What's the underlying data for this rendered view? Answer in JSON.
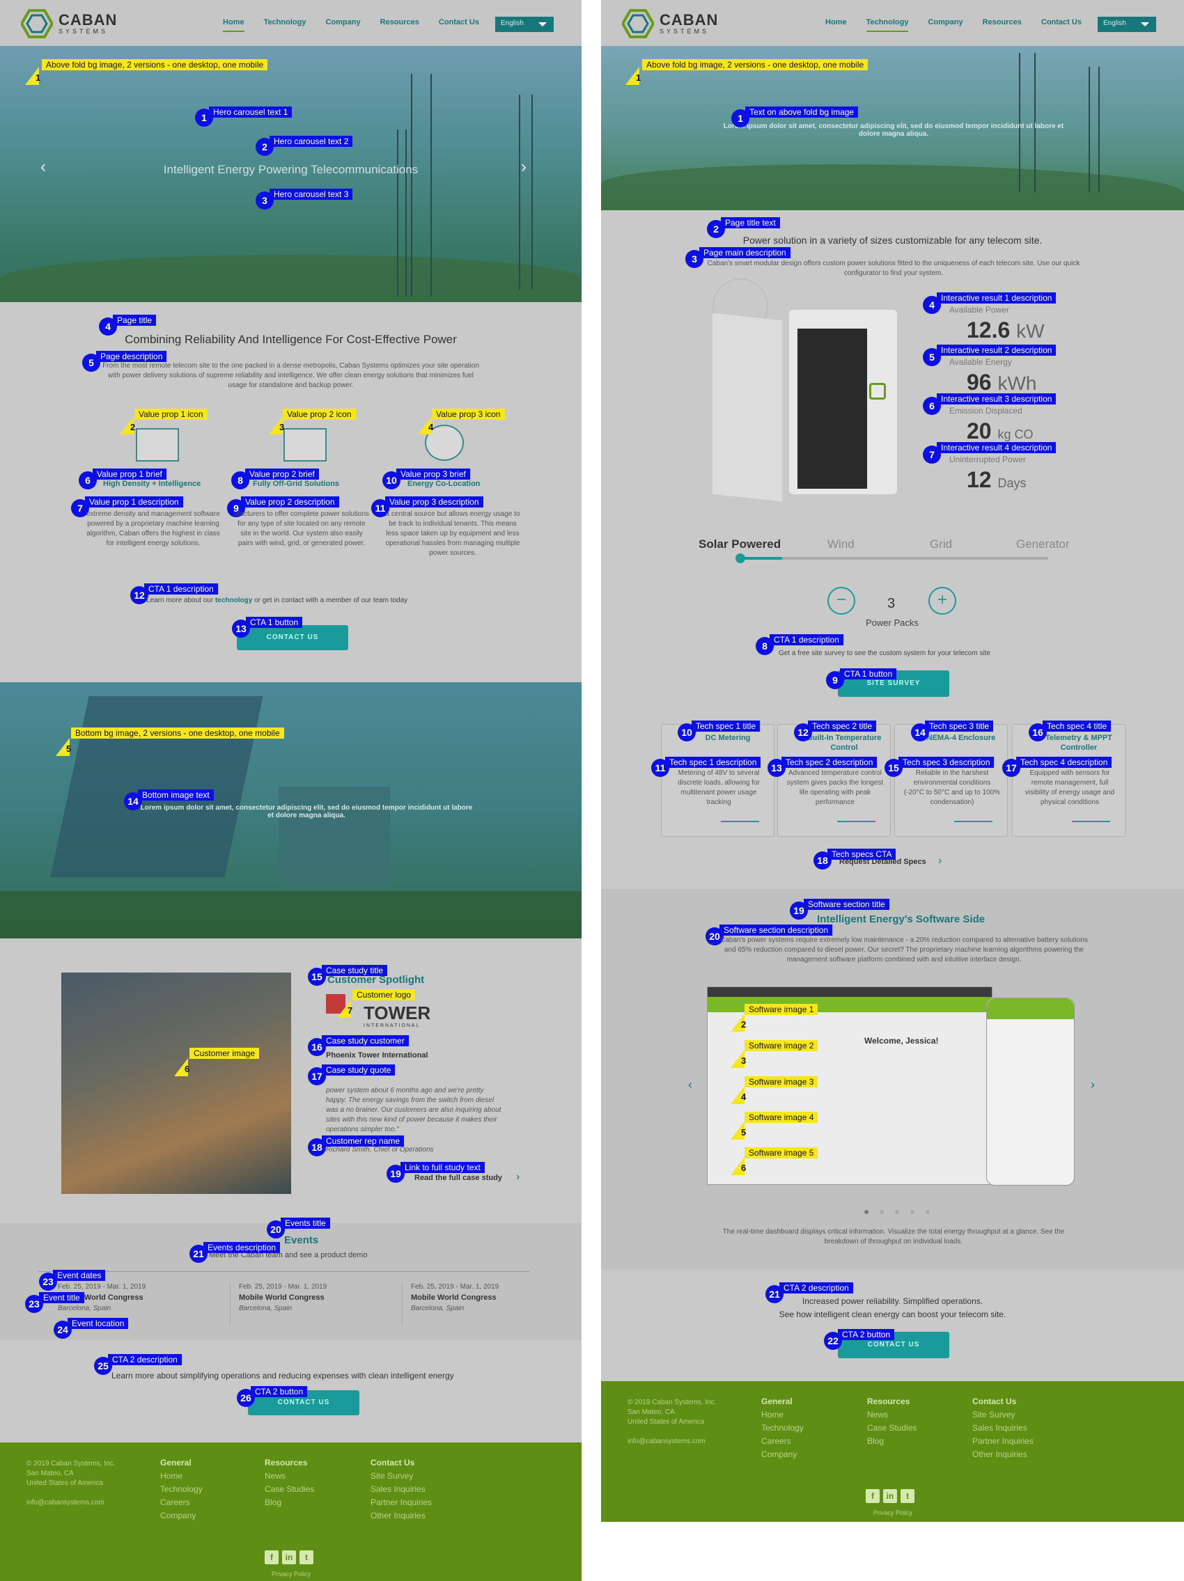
{
  "p1": {
    "logo": {
      "t1": "CABAN",
      "t2": "SYSTEMS"
    },
    "menu": [
      "Home",
      "Technology",
      "Company",
      "Resources",
      "Contact Us"
    ],
    "lang": "English",
    "hero_tag": "Above fold bg image, 2 versions - one desktop, one mobile",
    "hero_texts": [
      "Hero carousel text 1",
      "Hero carousel text 2",
      "Hero carousel text 3"
    ],
    "hero_main": "Intelligent Energy Powering Telecommunications",
    "page_title_tag": "Page title",
    "page_title": "Combining Reliability And Intelligence For Cost-Effective Power",
    "page_desc_tag": "Page description",
    "page_desc": "From the most remote telecom site to the one packed in a dense metropolis, Caban Systems optimizes your site operation with power delivery solutions of supreme reliability and intelligence. We offer clean energy solutions that minimizes fuel usage for standalone and backup power.",
    "vp_icon_tags": [
      "Value prop 1 icon",
      "Value prop 2 icon",
      "Value prop 3 icon"
    ],
    "vp_brief_tags": [
      "Value prop 1 brief",
      "Value prop 2 brief",
      "Value prop 3 brief"
    ],
    "vp_briefs": [
      "High Density + Intelligence",
      "Fully Off-Grid Solutions",
      "Energy Co-Location"
    ],
    "vp_desc_tags": [
      "Value prop 1 description",
      "Value prop 2 description",
      "Value prop 3 description"
    ],
    "vp_descs": [
      "extreme density and management software powered by a proprietary machine learning algorithm, Caban offers the highest in class for intelligent energy solutions.",
      "ufacturers to offer complete power solutions for any type of site located on any remote site in the world. Our system also easily pairs with wind, grid, or generated power.",
      "a central source but allows energy usage to be track to individual tenants. This means less space taken up by equipment and less operational hassles from managing multiple power sources."
    ],
    "cta1_tag": "CTA 1 description",
    "cta1_pre": "Learn more about our ",
    "cta1_link": "technology",
    "cta1_post": " or get in contact with a member of our team today",
    "cta1_btn_tag": "CTA 1 button",
    "cta1_btn": "CONTACT US",
    "bottom_tag": "Bottom bg image, 2 versions - one desktop, one mobile",
    "bottom_text_tag": "Bottom image text",
    "bottom_text": "Lorem ipsum dolor sit amet, consectetur adipiscing elit, sed do eiusmod tempor incididunt ut labore et dolore magna aliqua.",
    "case_title_tag": "Case study title",
    "case_title": "Customer Spotlight",
    "case_logo_tag": "Customer logo",
    "case_logo": "TOWER",
    "case_logo_sub": "INTERNATIONAL",
    "case_image_tag": "Customer image",
    "case_customer_tag": "Case study customer",
    "case_customer": "Phoenix Tower International",
    "case_quote_tag": "Case study quote",
    "case_quote": "power system about 6 months ago and we're pretty happy. The energy savings from the switch from diesel was a no brainer. Our customers are also inquiring about sites with this new kind of power because it makes their operations simpler too.\"",
    "case_rep_tag": "Customer rep name",
    "case_rep": "Richard Smith, Chief of Operations",
    "case_link_tag": "Link to full study text",
    "case_link": "Read the full case study",
    "events_title_tag": "Events title",
    "events_title": "Events",
    "events_desc_tag": "Events description",
    "events_desc": "Meet the Caban team and see a product demo",
    "event_dates_tag": "Event dates",
    "event_title_tag": "Event title",
    "event_loc_tag": "Event location",
    "events": [
      {
        "date": "Feb. 25, 2019 - Mar. 1, 2019",
        "title": "Mobile World Congress",
        "loc": "Barcelona, Spain"
      },
      {
        "date": "Feb. 25, 2019 - Mar. 1, 2019",
        "title": "Mobile World Congress",
        "loc": "Barcelona, Spain"
      },
      {
        "date": "Feb. 25, 2019 - Mar. 1, 2019",
        "title": "Mobile World Congress",
        "loc": "Barcelona, Spain"
      }
    ],
    "cta2_tag": "CTA 2 description",
    "cta2": "Learn more about simplifying operations and reducing expenses with clean intelligent energy",
    "cta2_btn_tag": "CTA 2 button",
    "cta2_btn": "CONTACT US"
  },
  "p2": {
    "hero_tag": "Above fold bg image, 2 versions - one desktop, one mobile",
    "hero_text_tag": "Text on above fold bg image",
    "hero_text": "Lorem ipsum dolor sit amet, consectetur adipiscing elit, sed do eiusmod tempor incididunt ut labore et dolore magna aliqua.",
    "title_tag": "Page title text",
    "title": "Power solution in a variety of sizes customizable for any telecom site.",
    "desc_tag": "Page main description",
    "desc": "Caban's smart modular design offers custom power solutions fitted to the uniqueness of each telecom site. Use our quick configurator to find your system.",
    "result_tags": [
      "Interactive result 1 description",
      "Interactive result 2 description",
      "Interactive result 3 description",
      "Interactive result 4 description"
    ],
    "results": [
      {
        "label": "Available Power",
        "value": "12.6",
        "unit": "kW"
      },
      {
        "label": "Available Energy",
        "value": "96",
        "unit": "kWh"
      },
      {
        "label": "Emission Displaced",
        "value": "20",
        "unit": "kg CO"
      },
      {
        "label": "Uninterrupted Power",
        "value": "12",
        "unit": "Days"
      }
    ],
    "sources": [
      "Solar Powered",
      "Wind",
      "Grid",
      "Generator"
    ],
    "packs_count": "3",
    "packs_label": "Power Packs",
    "cta1_tag": "CTA 1 description",
    "cta1": "Get a free site survey to see the custom system for your telecom site",
    "cta1_btn_tag": "CTA 1 button",
    "cta1_btn": "SITE SURVEY",
    "spec_title_tags": [
      "Tech spec 1 title",
      "Tech spec 2 title",
      "Tech spec 3 title",
      "Tech spec 4 title"
    ],
    "spec_desc_tags": [
      "Tech spec 1 description",
      "Tech spec 2 description",
      "Tech spec 3 description",
      "Tech spec 4 description"
    ],
    "specs": [
      {
        "title": "DC Metering",
        "desc": "Metering of 48V to several discrete loads, allowing for multitenant power usage tracking"
      },
      {
        "title": "Built-In Temperature Control",
        "desc": "Advanced temperature control system gives packs the longest life operating with peak performance"
      },
      {
        "title": "NEMA-4 Enclosure",
        "desc": "Reliable in the harshest environmental conditions (-20°C to 50°C and up to 100% condensation)"
      },
      {
        "title": "Telemetry & MPPT Controller",
        "desc": "Equipped with sensors for remote management, full visibility of energy usage and physical conditions"
      }
    ],
    "specs_cta_tag": "Tech specs CTA",
    "specs_cta": "Request Detailed Specs",
    "sw_title_tag": "Software section title",
    "sw_title": "Intelligent Energy's Software Side",
    "sw_desc_tag": "Software section description",
    "sw_desc": "Caban's power systems require extremely low maintenance - a 20% reduction compared to alternative battery solutions and 65% reduction compared to diesel power. Our secret? The proprietary machine learning algorithms powering the management software platform combined with and intuitive interface design.",
    "sw_image_tags": [
      "Software image 1",
      "Software image 2",
      "Software image 3",
      "Software image 4",
      "Software image 5"
    ],
    "sw_welcome": "Welcome, Jessica!",
    "sw_caption": "The real-time dashboard displays critical information. Visualize the total energy throughput at a glance. See the breakdown of throughput on individual loads.",
    "cta2_tag": "CTA 2 description",
    "cta2_l1": "Increased power reliability. Simplified operations.",
    "cta2_l2": "See how intelligent clean energy can boost your telecom site.",
    "cta2_btn_tag": "CTA 2 button",
    "cta2_btn": "CONTACT US"
  },
  "footer": {
    "company": [
      "© 2019 Caban Systems, Inc.",
      "San Mateo, CA",
      "United States of America",
      "",
      "info@cabansystems.com"
    ],
    "general_h": "General",
    "general": [
      "Home",
      "Technology",
      "Careers",
      "Company"
    ],
    "resources_h": "Resources",
    "resources": [
      "News",
      "Case Studies",
      "Blog"
    ],
    "contact_h": "Contact Us",
    "contact": [
      "Site Survey",
      "Sales Inquiries",
      "Partner Inquiries",
      "Other Inquiries"
    ],
    "privacy": "Privacy Policy"
  }
}
